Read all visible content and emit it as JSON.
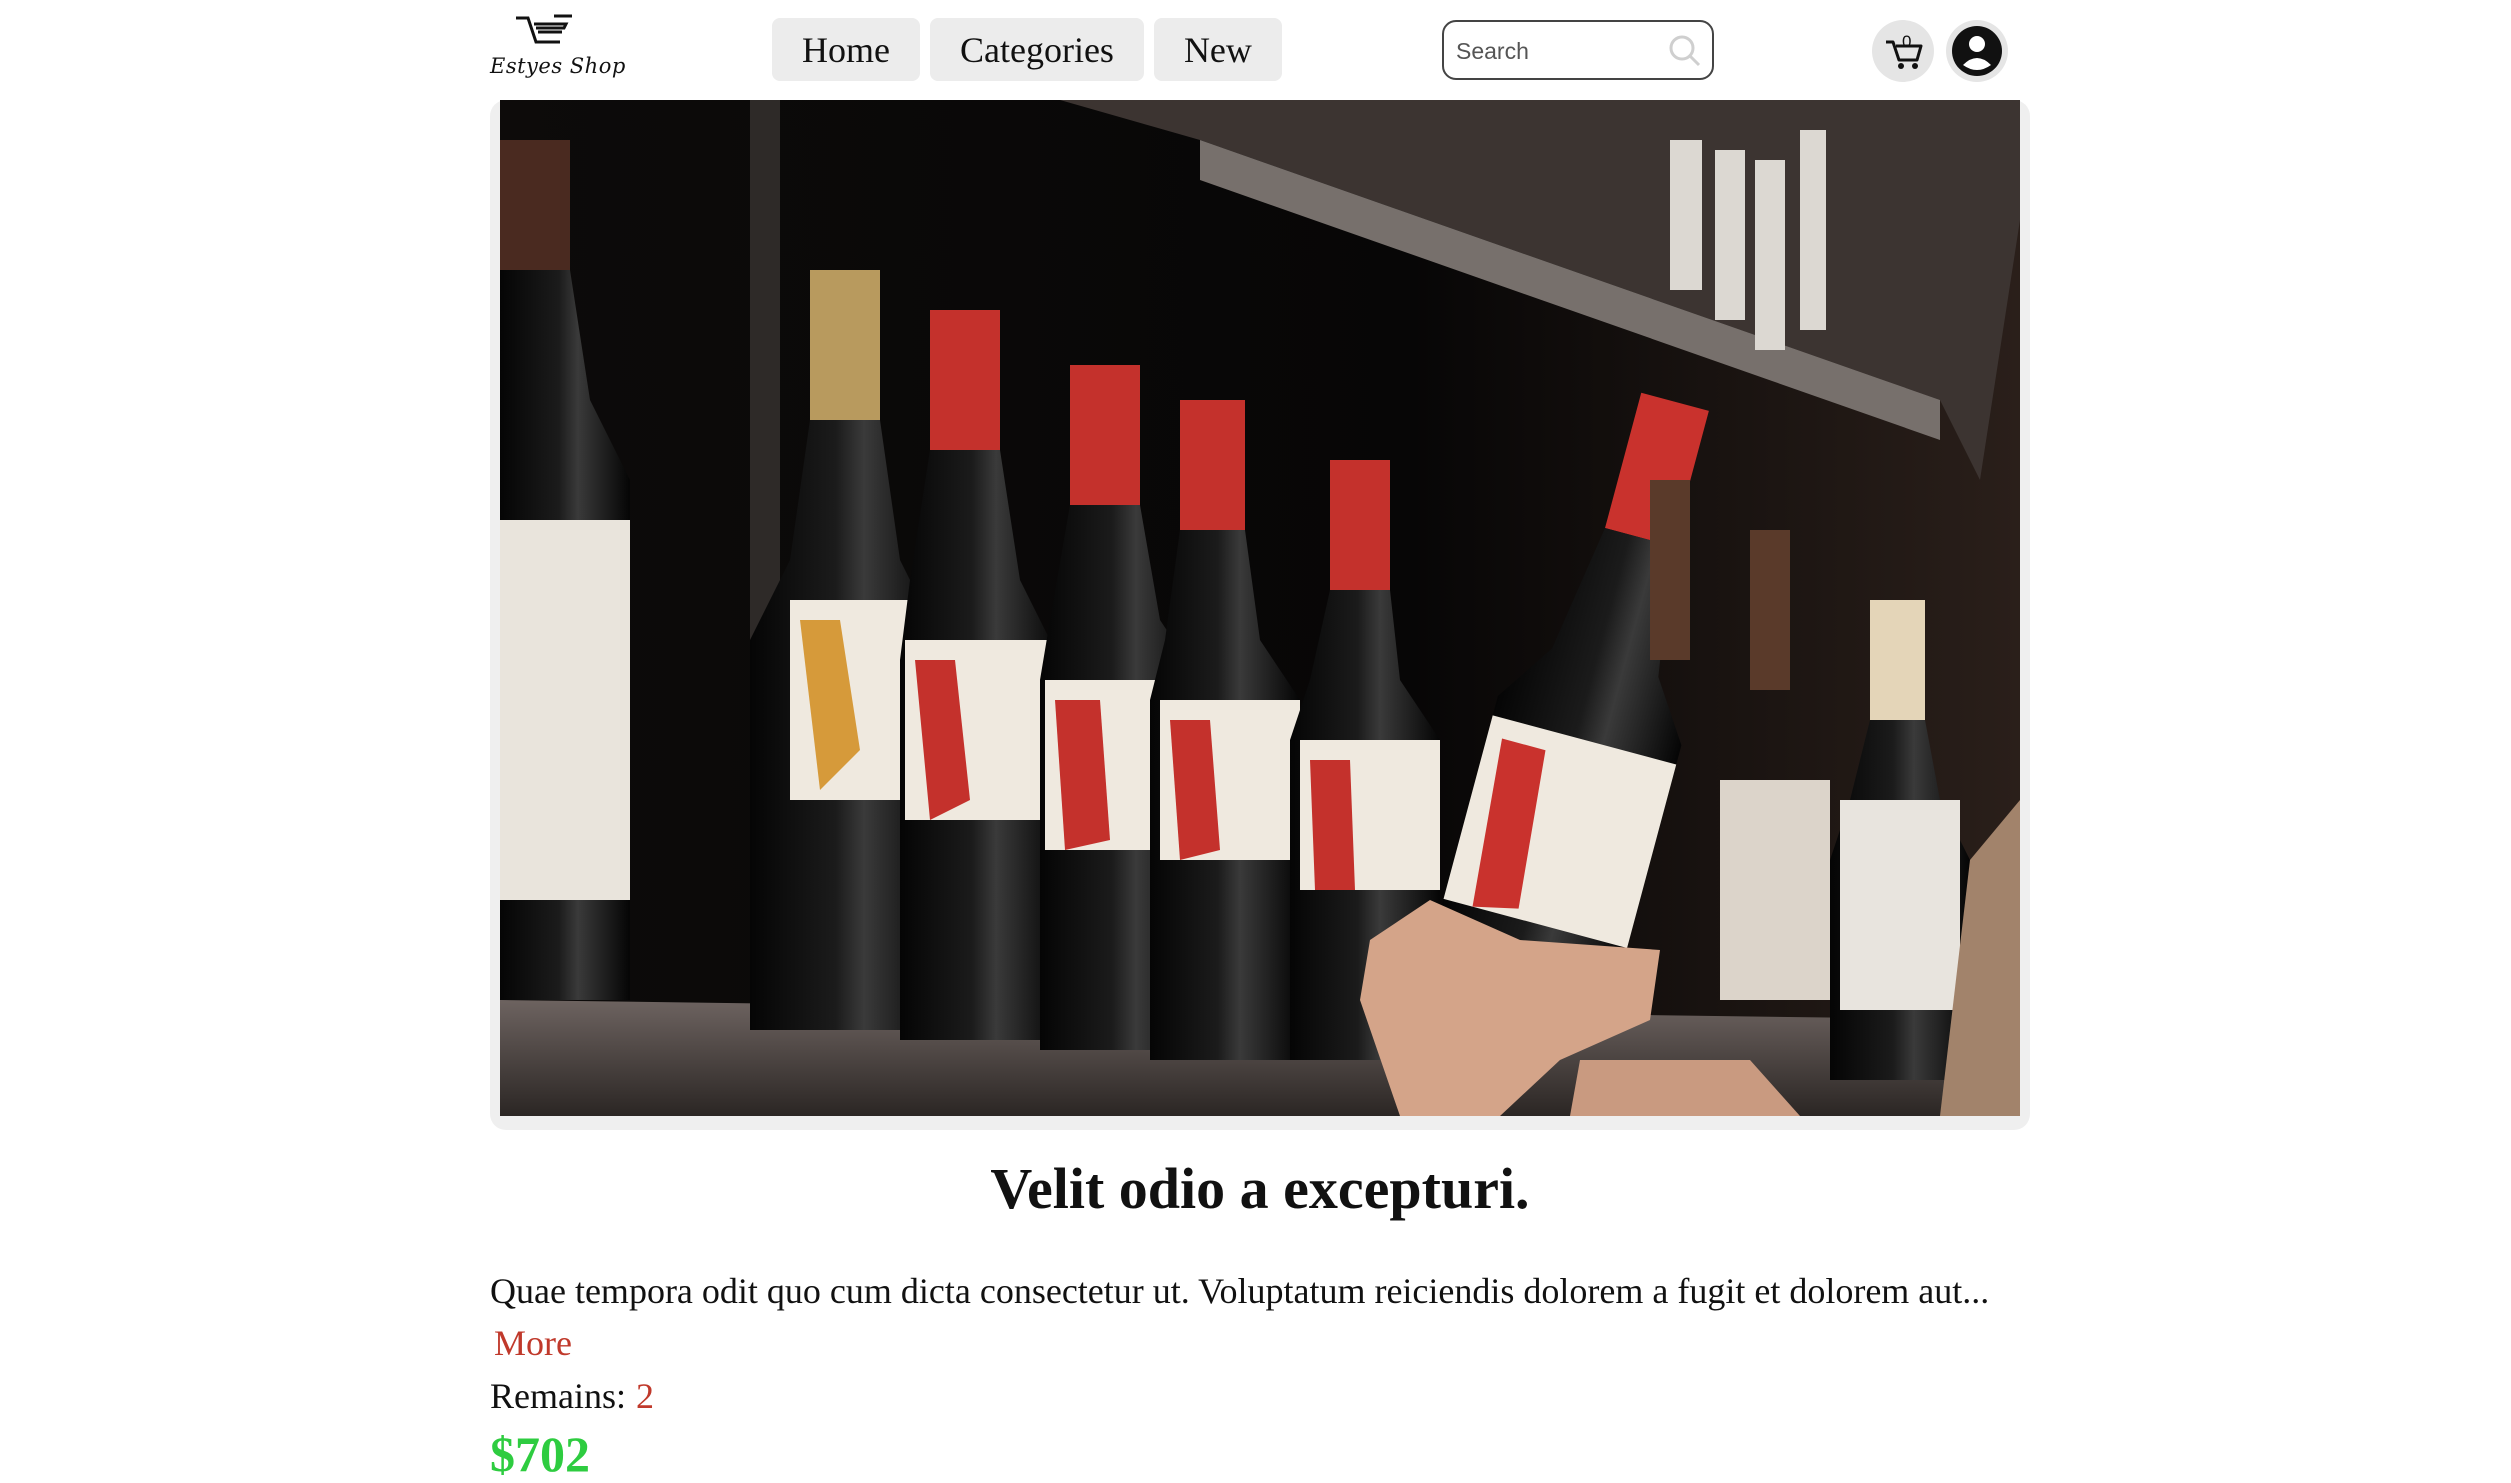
{
  "header": {
    "logo_text": "Estyes Shop",
    "nav": [
      {
        "label": "Home"
      },
      {
        "label": "Categories"
      },
      {
        "label": "New"
      }
    ],
    "search": {
      "placeholder": "Search"
    },
    "cart": {
      "count": "0"
    }
  },
  "product": {
    "title": "Velit odio a excepturi.",
    "description": "Quae tempora odit quo cum dicta consectetur ut. Voluptatum reiciendis dolorem a fugit et dolorem aut...",
    "more_label": "More",
    "remains_label": "Remains:",
    "remains_value": "2",
    "price": "$702"
  },
  "colors": {
    "accent_red": "#c0392b",
    "price_green": "#2ecc40",
    "nav_bg": "#ececec"
  },
  "icons": [
    "cart-icon",
    "user-icon",
    "search-icon",
    "logo-cart-icon"
  ]
}
